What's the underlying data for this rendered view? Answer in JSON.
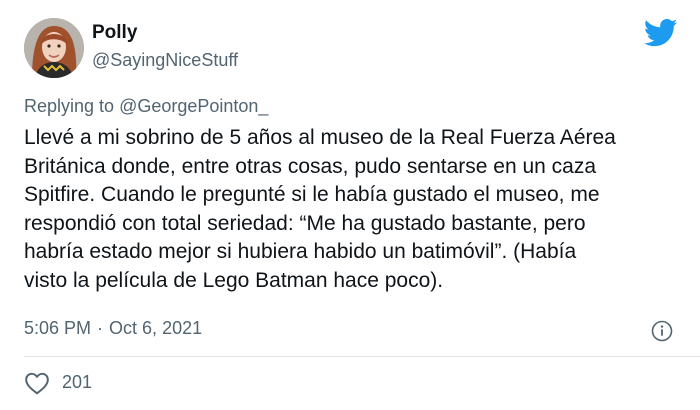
{
  "author": {
    "name": "Polly",
    "handle": "@SayingNiceStuff",
    "avatar_icon": "profile-photo"
  },
  "brand": {
    "icon": "twitter-bird-icon",
    "color": "#1d9bf0"
  },
  "reply": {
    "label": "Replying to",
    "target": "@GeorgePointon_"
  },
  "tweet": {
    "lines": [
      "Llevé a mi sobrino de 5 años al museo de la Real Fuerza Aérea",
      "Británica donde, entre otras cosas, pudo sentarse en un caza",
      "Spitfire. Cuando le pregunté si le había gustado el museo, me",
      "respondió con total seriedad: “Me ha gustado bastante, pero",
      "habría estado mejor si hubiera habido un batimóvil”. (Había",
      "visto la película de Lego Batman hace poco)."
    ],
    "time": "5:06 PM",
    "separator": "·",
    "date": "Oct 6, 2021"
  },
  "actions": {
    "info_icon": "info-icon",
    "like_icon": "heart-icon",
    "like_count": "201"
  },
  "colors": {
    "text": "#0f1419",
    "secondary": "#536471",
    "divider": "#dfe4e8"
  }
}
